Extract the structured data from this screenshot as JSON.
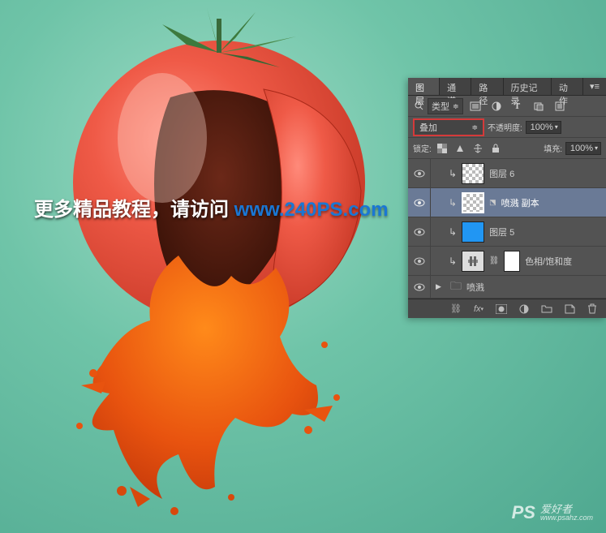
{
  "promo": {
    "text_a": "更多精品教程，请访问 ",
    "url": "www.240PS.com"
  },
  "watermark": {
    "prefix": "PS",
    "text": "爱好者",
    "site": "www.psahz.com"
  },
  "panel": {
    "tabs": {
      "layers": "图层",
      "channels": "通道",
      "paths": "路径",
      "history": "历史记录",
      "actions": "动作"
    },
    "filter": {
      "kind_label": "类型"
    },
    "blend": {
      "mode": "叠加",
      "opacity_label": "不透明度:",
      "opacity_value": "100%"
    },
    "lock": {
      "label": "锁定:",
      "fill_label": "填充:",
      "fill_value": "100%"
    },
    "layers": [
      {
        "name": "图层 6"
      },
      {
        "name": "喷溅 副本"
      },
      {
        "name": "图层 5"
      },
      {
        "name": "色相/饱和度"
      },
      {
        "name": "喷溅"
      }
    ]
  }
}
